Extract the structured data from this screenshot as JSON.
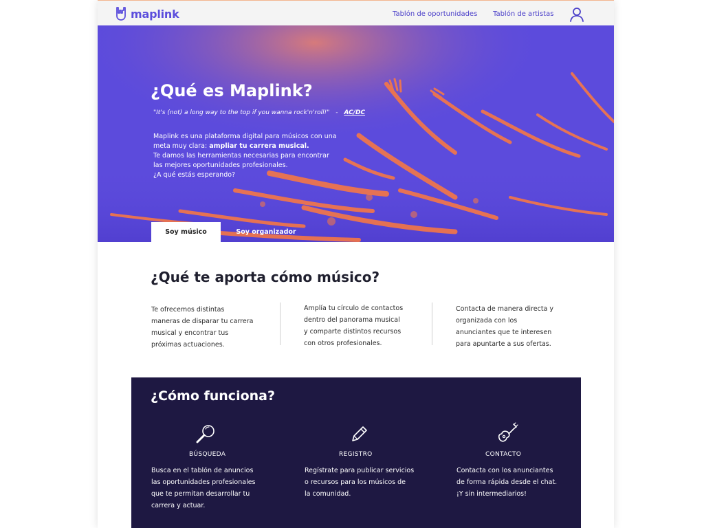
{
  "header": {
    "logo_text": "maplink",
    "nav": [
      "Tablón de oportunidades",
      "Tablón de artistas"
    ],
    "user_icon": "user-icon"
  },
  "hero": {
    "title": "¿Qué es Maplink?",
    "quote": "\"It's (not) a long way to the top if you wanna rock'n'roll!\"",
    "quote_separator": "-",
    "quote_author": "AC/DC",
    "body": {
      "line1": "Maplink es una plataforma digital para músicos con una",
      "line2_prefix": "meta muy clara: ",
      "line2_bold": "ampliar tu carrera musical.",
      "line3": "Te damos las herramientas necesarias para encontrar",
      "line4": "las mejores oportunidades profesionales.",
      "line5": "¿A qué estás esperando?"
    },
    "tabs": [
      "Soy músico",
      "Soy organizador"
    ],
    "active_tab": "Soy músico"
  },
  "benefits": {
    "title": "¿Qué te aporta cómo músico?",
    "columns": [
      [
        "Te ofrecemos distintas",
        "maneras de disparar tu carrera",
        "musical y encontrar tus",
        "próximas actuaciones."
      ],
      [
        "Amplía tu círculo de contactos",
        "dentro del panorama musical",
        "y comparte distintos recursos",
        "con otros profesionales."
      ],
      [
        "Contacta de manera directa y",
        "organizada con los",
        "anunciantes que te interesen",
        "para apuntarte a sus ofertas."
      ]
    ]
  },
  "how": {
    "title": "¿Cómo funciona?",
    "steps": [
      {
        "icon": "magnifier-icon",
        "label": "BÚSQUEDA",
        "lines": [
          "Busca en el tablón de anuncios",
          "las oportunidades profesionales",
          "que te permitan desarrollar tu",
          "carrera y actuar."
        ]
      },
      {
        "icon": "pencil-icon",
        "label": "REGISTRO",
        "lines": [
          "Regístrate para publicar servicios",
          "o recursos para los músicos de",
          "la comunidad."
        ]
      },
      {
        "icon": "guitar-icon",
        "label": "CONTACTO",
        "lines": [
          "Contacta con los anunciantes",
          "de forma rápida desde el chat.",
          "¡Y sin intermediarios!"
        ]
      }
    ]
  },
  "colors": {
    "brand": "#5b4ddc",
    "hero_bg": "#5c4bdc",
    "hero_accent": "#ff7a3d",
    "dark_section": "#1e1842"
  }
}
